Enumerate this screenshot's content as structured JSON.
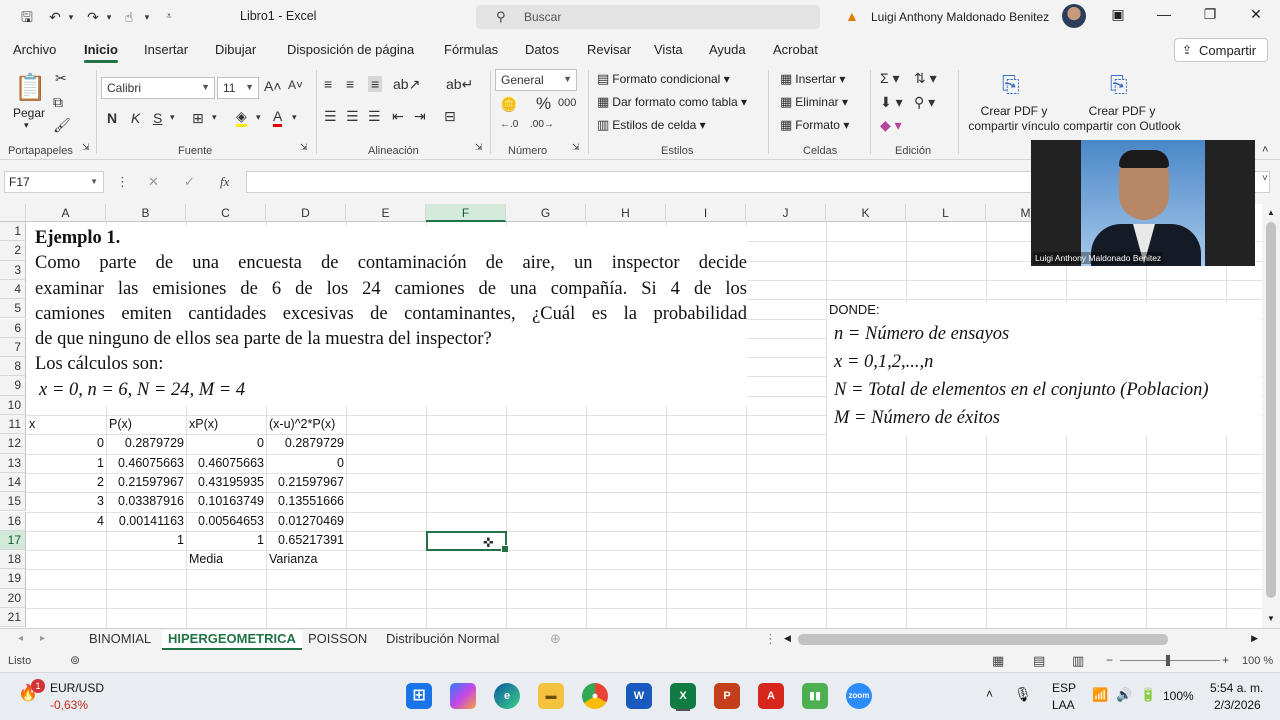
{
  "titlebar": {
    "title": "Libro1 - Excel",
    "search_placeholder": "Buscar",
    "user_name": "Luigi Anthony Maldonado Benitez"
  },
  "menu": {
    "items": [
      "Archivo",
      "Inicio",
      "Insertar",
      "Dibujar",
      "Disposición de página",
      "Fórmulas",
      "Datos",
      "Revisar",
      "Vista",
      "Ayuda",
      "Acrobat"
    ],
    "active": "Inicio",
    "share_label": "Compartir"
  },
  "ribbon": {
    "clipboard": {
      "paste": "Pegar",
      "label": "Portapapeles"
    },
    "font": {
      "name": "Calibri",
      "size": "11",
      "bold": "N",
      "italic": "K",
      "underline": "S",
      "label": "Fuente"
    },
    "alignment": {
      "label": "Alineación"
    },
    "number": {
      "format": "General",
      "percent": "%",
      "thousands": "000",
      "label": "Número"
    },
    "styles": {
      "conditional": "Formato condicional",
      "as_table": "Dar formato como tabla",
      "cell_styles": "Estilos de celda",
      "label": "Estilos"
    },
    "cells": {
      "insert": "Insertar",
      "delete": "Eliminar",
      "format": "Formato",
      "label": "Celdas"
    },
    "editing": {
      "label": "Edición"
    },
    "acrobat": {
      "pdf_link": "Crear PDF y compartir vínculo",
      "pdf_outlook": "Crear PDF y compartir con Outlook"
    }
  },
  "formula_bar": {
    "name_box": "F17",
    "fx": "fx",
    "value": ""
  },
  "columns": [
    "A",
    "B",
    "C",
    "D",
    "E",
    "F",
    "G",
    "H",
    "I",
    "J",
    "K",
    "L",
    "M"
  ],
  "selected_column": "F",
  "rows": [
    "1",
    "2",
    "3",
    "4",
    "5",
    "6",
    "7",
    "8",
    "9",
    "10",
    "11",
    "12",
    "13",
    "14",
    "15",
    "16",
    "17",
    "18",
    "19",
    "20",
    "21"
  ],
  "selected_row": "17",
  "problem_text": {
    "title": "Ejemplo 1.",
    "lines": [
      "Como parte de una encuesta de contaminación de aire, un inspector decide",
      "examinar las emisiones de 6 de los 24 camiones de una compañía. Si 4 de los",
      "camiones emiten cantidades excesivas de contaminantes, ¿Cuál es la probabilidad",
      "de que ninguno de ellos sea parte de la muestra del inspector?"
    ],
    "calc_intro": "Los cálculos son:",
    "params": "x = 0, n = 6, N = 24, M = 4"
  },
  "definitions": {
    "header": "DONDE:",
    "lines": [
      "n = Número de ensayos",
      "x = 0,1,2,...,n",
      "N = Total de elementos en el conjunto (Poblacion)",
      "M = Número de éxitos"
    ]
  },
  "table": {
    "headers": [
      "x",
      "P(x)",
      "xP(x)",
      "(x-u)^2*P(x)"
    ],
    "rows": [
      [
        "0",
        "0.2879729",
        "0",
        "0.2879729"
      ],
      [
        "1",
        "0.46075663",
        "0.46075663",
        "0"
      ],
      [
        "2",
        "0.21597967",
        "0.43195935",
        "0.21597967"
      ],
      [
        "3",
        "0.03387916",
        "0.10163749",
        "0.13551666"
      ],
      [
        "4",
        "0.00141163",
        "0.00564653",
        "0.01270469"
      ]
    ],
    "totals": [
      "",
      "1",
      "1",
      "0.65217391"
    ],
    "labels": [
      "",
      "",
      "Media",
      "Varianza"
    ]
  },
  "webcam": {
    "label": "Luigi Anthony Maldonado Benitez"
  },
  "sheets": [
    "BINOMIAL",
    "HIPERGEOMETRICA",
    "POISSON",
    "Distribución Normal"
  ],
  "active_sheet": "HIPERGEOMETRICA",
  "status": {
    "ready": "Listo",
    "zoom": "100 %"
  },
  "taskbar": {
    "ticker_name": "EUR/USD",
    "ticker_change": "-0,63%",
    "ticker_badge": "1",
    "lang": "ESP",
    "lang2": "LAA",
    "battery": "100%",
    "time": "5:54 a. m.",
    "date": "2/3/2026",
    "apps": [
      "windows-start",
      "copilot",
      "edge",
      "file-explorer",
      "chrome",
      "word",
      "excel",
      "powerpoint",
      "acrobat",
      "charts",
      "zoom"
    ]
  },
  "colors": {
    "accent": "#217346",
    "selection_header": "#d3e9da",
    "warning": "#e07a00"
  }
}
